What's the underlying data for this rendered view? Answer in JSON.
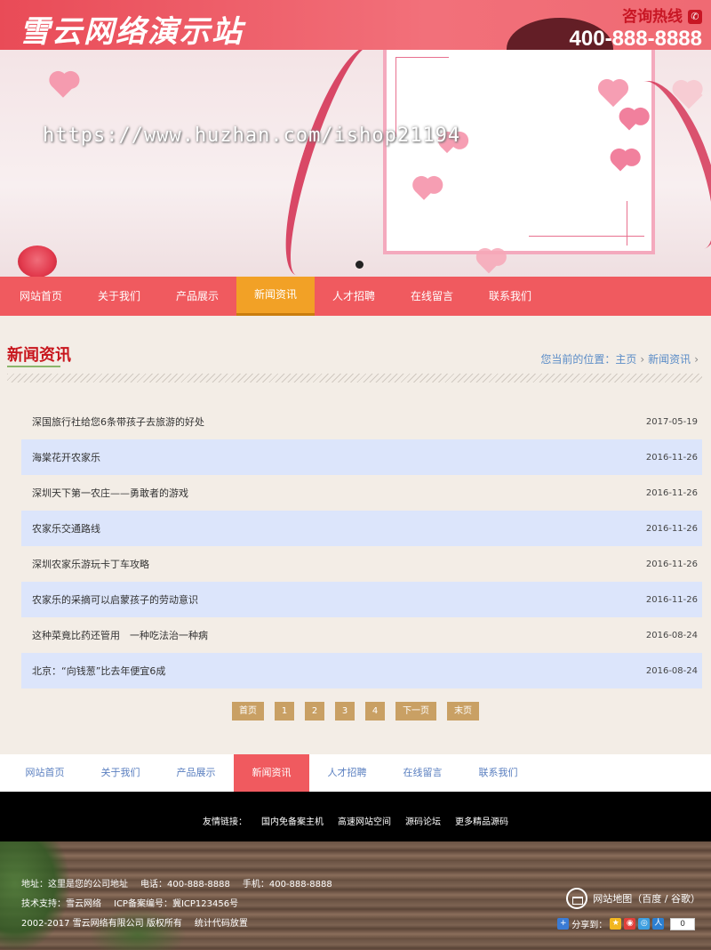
{
  "header": {
    "logo": "雪云网络演示站",
    "hotline_label": "咨询热线",
    "hotline_number": "400-888-8888"
  },
  "banner": {
    "watermark": "https://www.huzhan.com/ishop21194"
  },
  "nav": {
    "items": [
      {
        "label": "网站首页"
      },
      {
        "label": "关于我们"
      },
      {
        "label": "产品展示"
      },
      {
        "label": "新闻资讯"
      },
      {
        "label": "人才招聘"
      },
      {
        "label": "在线留言"
      },
      {
        "label": "联系我们"
      }
    ],
    "active_index": 3
  },
  "content": {
    "title": "新闻资讯",
    "breadcrumb": {
      "prefix": "您当前的位置：",
      "home": "主页",
      "current": "新闻资讯"
    },
    "news": [
      {
        "title": "深国旅行社给您6条带孩子去旅游的好处",
        "date": "2017-05-19"
      },
      {
        "title": "海棠花开农家乐",
        "date": "2016-11-26"
      },
      {
        "title": "深圳天下第一农庄——勇敢者的游戏",
        "date": "2016-11-26"
      },
      {
        "title": "农家乐交通路线",
        "date": "2016-11-26"
      },
      {
        "title": "深圳农家乐游玩卡丁车攻略",
        "date": "2016-11-26"
      },
      {
        "title": "农家乐的采摘可以启蒙孩子的劳动意识",
        "date": "2016-11-26"
      },
      {
        "title": "这种菜竟比药还管用　一种吃法治一种病",
        "date": "2016-08-24"
      },
      {
        "title": "北京：“向钱葱”比去年便宜6成",
        "date": "2016-08-24"
      }
    ],
    "pager": {
      "first": "首页",
      "pages": [
        "1",
        "2",
        "3",
        "4"
      ],
      "next": "下一页",
      "last": "末页"
    }
  },
  "footer_nav": {
    "items": [
      {
        "label": "网站首页"
      },
      {
        "label": "关于我们"
      },
      {
        "label": "产品展示"
      },
      {
        "label": "新闻资讯"
      },
      {
        "label": "人才招聘"
      },
      {
        "label": "在线留言"
      },
      {
        "label": "联系我们"
      }
    ]
  },
  "links": {
    "label": "友情链接：",
    "items": [
      "国内免备案主机",
      "高速网站空间",
      "源码论坛",
      "更多精品源码"
    ]
  },
  "footer": {
    "address": "地址：这里是您的公司地址",
    "tel": "电话：400-888-8888",
    "mobile": "手机：400-888-8888",
    "support": "技术支持：雪云网络",
    "icp": "ICP备案编号：冀ICP123456号",
    "copyright": "2002-2017 雪云网络有限公司 版权所有",
    "stats": "统计代码放置",
    "sitemap": "网站地图（百度 / 谷歌）",
    "share_label": "分享到：",
    "share_count": "0"
  },
  "colors": {
    "primary": "#f05a5f",
    "active_nav": "#f2a126",
    "title_red": "#c8161d",
    "stripe": "#dce5fb",
    "pager": "#c9a064"
  }
}
